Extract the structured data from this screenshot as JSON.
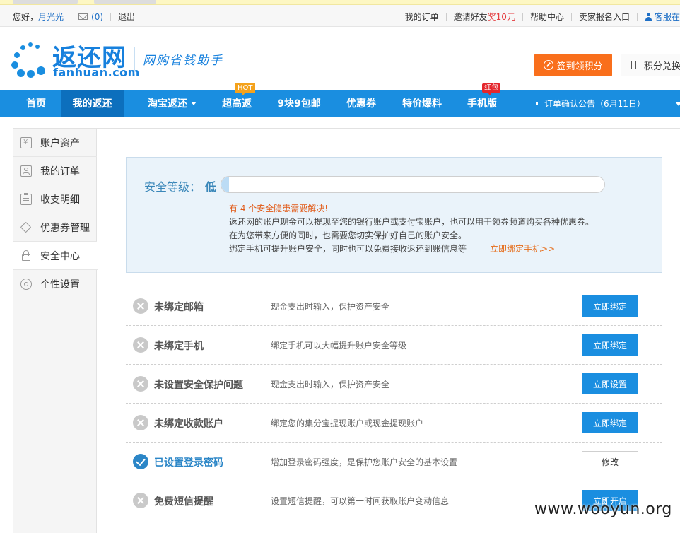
{
  "topbar": {
    "greeting": "您好，",
    "username": "月光光",
    "mail_count": "(0)",
    "logout": "退出",
    "links": {
      "orders": "我的订单",
      "invite_prefix": "邀请好友",
      "invite_reward": "奖10元",
      "help": "帮助中心",
      "seller": "卖家报名入口",
      "service": "客服在"
    }
  },
  "header": {
    "logo_main": "返还网",
    "logo_sub": "fanhuan.com",
    "slogan": "网购省钱助手",
    "signin_label": "签到领积分",
    "exchange_label": "积分兑换"
  },
  "nav": {
    "items": [
      {
        "label": "首页"
      },
      {
        "label": "我的返还"
      },
      {
        "label": "淘宝返还"
      },
      {
        "label": "超高返"
      },
      {
        "label": "9块9包邮"
      },
      {
        "label": "优惠券"
      },
      {
        "label": "特价爆料"
      },
      {
        "label": "手机版"
      }
    ],
    "hot_badge": "HOT",
    "red_badge": "红包",
    "notice": "订单确认公告（6月11日）"
  },
  "sidebar": {
    "items": [
      {
        "label": "账户资产",
        "icon": "yen-icon"
      },
      {
        "label": "我的订单",
        "icon": "order-icon"
      },
      {
        "label": "收支明细",
        "icon": "clipboard-icon"
      },
      {
        "label": "优惠券管理",
        "icon": "tag-icon"
      },
      {
        "label": "安全中心",
        "icon": "lock-icon"
      },
      {
        "label": "个性设置",
        "icon": "gear-icon"
      }
    ]
  },
  "security": {
    "title": "安全等级：",
    "level": "低",
    "level_progress": 0.02,
    "warning": "有 4 个安全隐患需要解决!",
    "lines": [
      "返还网的账户现金可以提现至您的银行账户或支付宝账户，也可以用于领券频道购买各种优惠券。",
      "在为您带来方便的同时，也需要您切实保护好自己的账户安全。",
      "绑定手机可提升账户安全，同时也可以免费接收返还到账信息等"
    ],
    "bind_link": "立即绑定手机>>"
  },
  "rows": [
    {
      "title": "未绑定邮箱",
      "desc": "现金支出时输入，保护资产安全",
      "button": "立即绑定",
      "done": false
    },
    {
      "title": "未绑定手机",
      "desc": "绑定手机可以大幅提升账户安全等级",
      "button": "立即绑定",
      "done": false
    },
    {
      "title": "未设置安全保护问题",
      "desc": "现金支出时输入，保护资产安全",
      "button": "立即设置",
      "done": false
    },
    {
      "title": "未绑定收款账户",
      "desc": "绑定您的集分宝提现账户或现金提现账户",
      "button": "立即绑定",
      "done": false
    },
    {
      "title": "已设置登录密码",
      "desc": "增加登录密码强度，是保护您账户安全的基本设置",
      "button": "修改",
      "done": true
    },
    {
      "title": "免费短信提醒",
      "desc": "设置短信提醒，可以第一时间获取账户变动信息",
      "button": "立即开启",
      "done": false
    }
  ],
  "watermark": "www.wooyun.org",
  "colors": {
    "nav_blue": "#1a8ee0",
    "nav_active": "#0c6fbd",
    "orange": "#f96f1c",
    "warning": "#e15a17",
    "ok_blue": "#2b86c7"
  }
}
